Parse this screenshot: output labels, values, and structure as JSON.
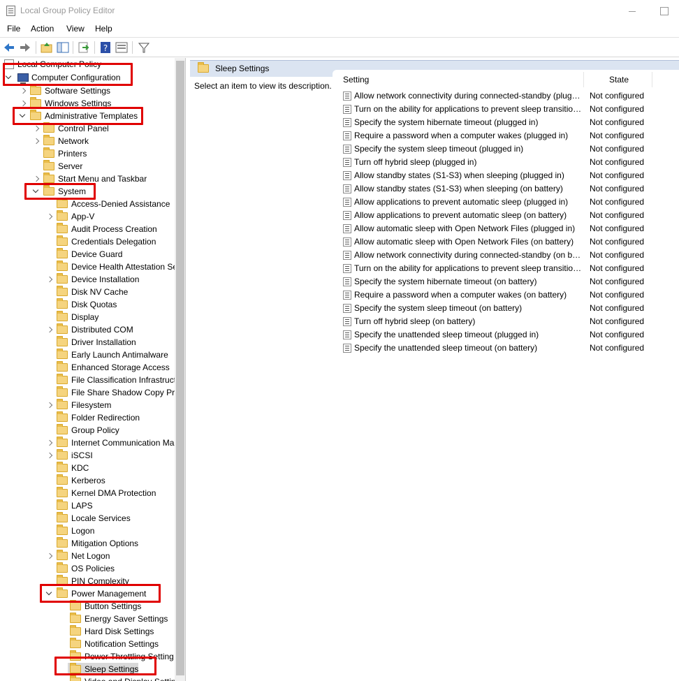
{
  "window": {
    "title": "Local Group Policy Editor"
  },
  "menu": [
    "File",
    "Action",
    "View",
    "Help"
  ],
  "toolbar": {
    "buttons": [
      "back-arrow-icon",
      "forward-arrow-icon",
      "up-folder-icon",
      "show-hide-tree-icon",
      "export-list-icon",
      "help-icon",
      "properties-view-icon",
      "filter-icon"
    ]
  },
  "tree": {
    "root": "Local Computer Policy",
    "computer_configuration": "Computer Configuration",
    "software_settings": "Software Settings",
    "windows_settings": "Windows Settings",
    "administrative_templates": "Administrative Templates",
    "control_panel": "Control Panel",
    "network": "Network",
    "printers": "Printers",
    "server": "Server",
    "start_menu": "Start Menu and Taskbar",
    "system": "System",
    "system_children": [
      "Access-Denied Assistance",
      "App-V",
      "Audit Process Creation",
      "Credentials Delegation",
      "Device Guard",
      "Device Health Attestation Se",
      "Device Installation",
      "Disk NV Cache",
      "Disk Quotas",
      "Display",
      "Distributed COM",
      "Driver Installation",
      "Early Launch Antimalware",
      "Enhanced Storage Access",
      "File Classification Infrastruct",
      "File Share Shadow Copy Pro",
      "Filesystem",
      "Folder Redirection",
      "Group Policy",
      "Internet Communication Ma",
      "iSCSI",
      "KDC",
      "Kerberos",
      "Kernel DMA Protection",
      "LAPS",
      "Locale Services",
      "Logon",
      "Mitigation Options",
      "Net Logon",
      "OS Policies",
      "PIN Complexity"
    ],
    "power_management": "Power Management",
    "power_children": [
      "Button Settings",
      "Energy Saver Settings",
      "Hard Disk Settings",
      "Notification Settings",
      "Power Throttling Setting",
      "Sleep Settings",
      "Video and Display Settin"
    ]
  },
  "right": {
    "header_title": "Sleep Settings",
    "description": "Select an item to view its description.",
    "columns": {
      "setting": "Setting",
      "state": "State"
    },
    "rows": [
      {
        "name": "Allow network connectivity during connected-standby (plugged in)",
        "state": "Not configured"
      },
      {
        "name": "Turn on the ability for applications to prevent sleep transitions (plugged in)",
        "state": "Not configured"
      },
      {
        "name": "Specify the system hibernate timeout (plugged in)",
        "state": "Not configured"
      },
      {
        "name": "Require a password when a computer wakes (plugged in)",
        "state": "Not configured"
      },
      {
        "name": "Specify the system sleep timeout (plugged in)",
        "state": "Not configured"
      },
      {
        "name": "Turn off hybrid sleep (plugged in)",
        "state": "Not configured"
      },
      {
        "name": "Allow standby states (S1-S3) when sleeping (plugged in)",
        "state": "Not configured"
      },
      {
        "name": "Allow standby states (S1-S3) when sleeping (on battery)",
        "state": "Not configured"
      },
      {
        "name": "Allow applications to prevent automatic sleep (plugged in)",
        "state": "Not configured"
      },
      {
        "name": "Allow applications to prevent automatic sleep (on battery)",
        "state": "Not configured"
      },
      {
        "name": "Allow automatic sleep with Open Network Files (plugged in)",
        "state": "Not configured"
      },
      {
        "name": "Allow automatic sleep with Open Network Files (on battery)",
        "state": "Not configured"
      },
      {
        "name": "Allow network connectivity during connected-standby (on battery)",
        "state": "Not configured"
      },
      {
        "name": "Turn on the ability for applications to prevent sleep transitions (on battery)",
        "state": "Not configured"
      },
      {
        "name": "Specify the system hibernate timeout (on battery)",
        "state": "Not configured"
      },
      {
        "name": "Require a password when a computer wakes (on battery)",
        "state": "Not configured"
      },
      {
        "name": "Specify the system sleep timeout (on battery)",
        "state": "Not configured"
      },
      {
        "name": "Turn off hybrid sleep (on battery)",
        "state": "Not configured"
      },
      {
        "name": "Specify the unattended sleep timeout (plugged in)",
        "state": "Not configured"
      },
      {
        "name": "Specify the unattended sleep timeout (on battery)",
        "state": "Not configured"
      }
    ]
  },
  "colors": {
    "highlight": "#e00000",
    "header_band": "#dbe4f1",
    "folder": "#f5d47f"
  }
}
